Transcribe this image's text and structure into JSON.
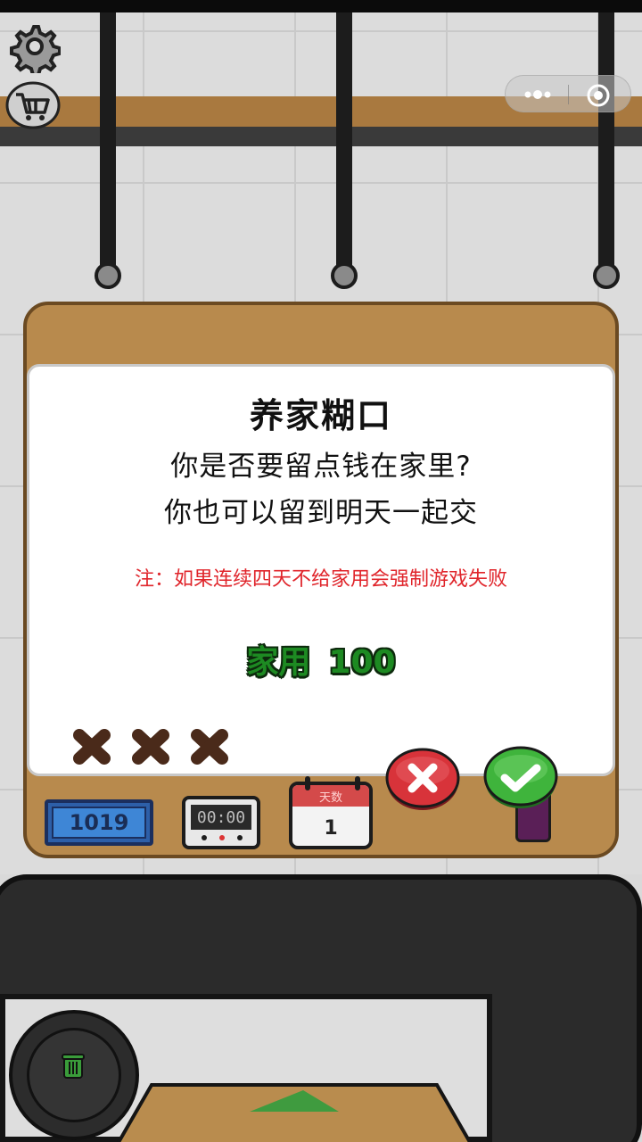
{
  "dialog": {
    "title": "养家糊口",
    "line1": "你是否要留点钱在家里?",
    "line2": "你也可以留到明天一起交",
    "note": "注：如果连续四天不给家用会强制游戏失败",
    "money_label": "家用",
    "money_value": "100",
    "strikes_shown": 3
  },
  "hud": {
    "money": "1019",
    "timer": "00:00",
    "calendar_label": "天数",
    "day": "1"
  },
  "icons": {
    "settings": "gear-icon",
    "shop": "cart-icon",
    "menu_more": "more-dots-icon",
    "menu_close": "target-close-icon",
    "cancel": "cancel-x-icon",
    "confirm": "confirm-check-icon",
    "strike": "strike-x-icon",
    "trash": "trash-can-icon"
  },
  "colors": {
    "note_red": "#e0252b",
    "money_green": "#1d8a22",
    "cancel_red": "#d8333a",
    "confirm_green": "#3fb43c",
    "strike_brown": "#4a2a1a",
    "board_wood": "#b88a4d"
  }
}
